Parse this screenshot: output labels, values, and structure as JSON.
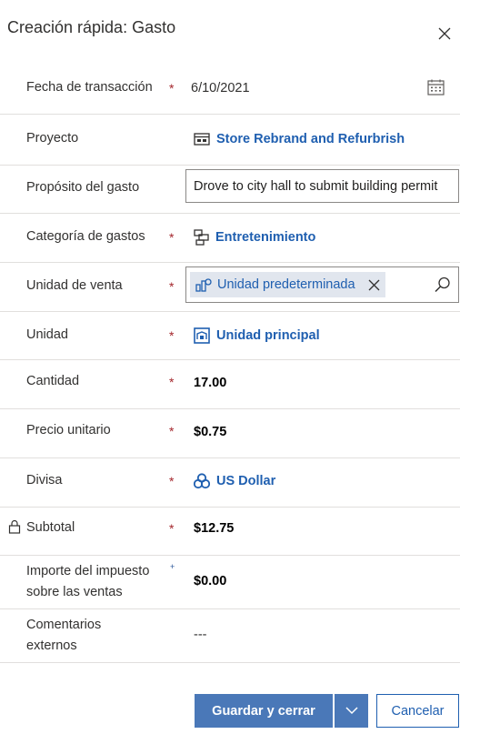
{
  "dialog": {
    "title": "Creación rápida: Gasto"
  },
  "fields": {
    "transaction_date": {
      "label": "Fecha de transacción",
      "required": "*",
      "value": "6/10/2021"
    },
    "project": {
      "label": "Proyecto",
      "value": "Store Rebrand and Refurbrish"
    },
    "purpose": {
      "label": "Propósito del gasto",
      "value": "Drove to city hall to submit building permit"
    },
    "category": {
      "label": "Categoría de gastos",
      "required": "*",
      "value": "Entretenimiento"
    },
    "sales_unit": {
      "label": "Unidad de venta",
      "required": "*",
      "value": "Unidad predeterminada"
    },
    "unit": {
      "label": "Unidad",
      "required": "*",
      "value": "Unidad principal"
    },
    "quantity": {
      "label": "Cantidad",
      "required": "*",
      "value": "17.00"
    },
    "unit_price": {
      "label": "Precio unitario",
      "required": "*",
      "value": "$0.75"
    },
    "currency": {
      "label": "Divisa",
      "required": "*",
      "value": "US Dollar"
    },
    "subtotal": {
      "label": "Subtotal",
      "required": "*",
      "value": "$12.75"
    },
    "sales_tax": {
      "label_line1": "Importe del impuesto",
      "label_line2": "sobre las ventas",
      "recommended": "+",
      "value": "$0.00"
    },
    "external_comments": {
      "label_line1": "Comentarios",
      "label_line2": "externos",
      "value": "---"
    }
  },
  "footer": {
    "save_close_label": "Guardar y cerrar",
    "cancel_label": "Cancelar"
  },
  "colors": {
    "link": "#1f5fb0",
    "required": "#a4262c",
    "primary_button": "#4a78b8"
  }
}
